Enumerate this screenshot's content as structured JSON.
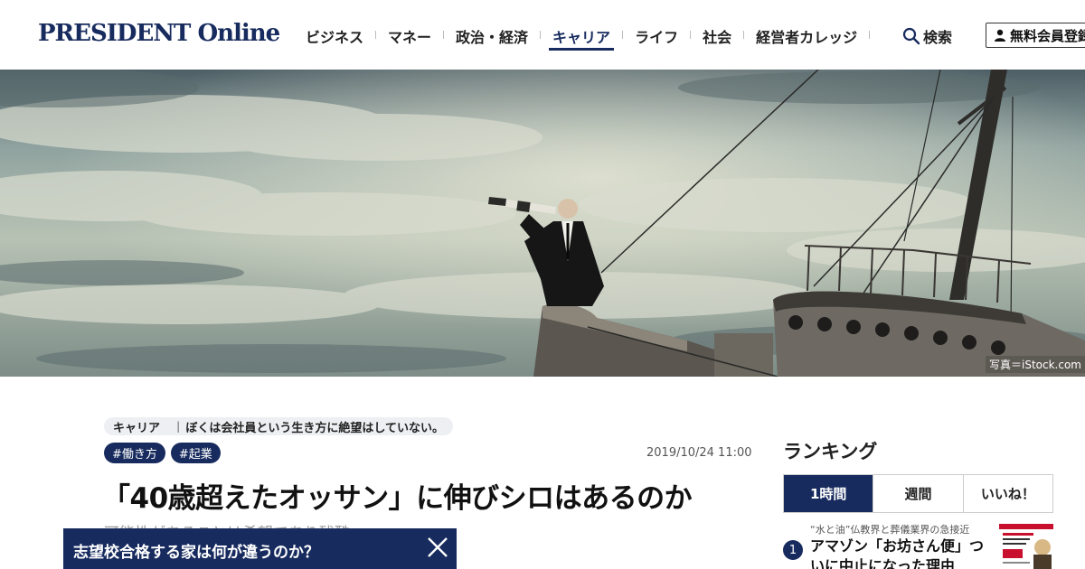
{
  "header": {
    "logo": "PRESIDENT Online",
    "nav": [
      {
        "label": "ビジネス",
        "active": false
      },
      {
        "label": "マネー",
        "active": false
      },
      {
        "label": "政治・経済",
        "active": false
      },
      {
        "label": "キャリア",
        "active": true
      },
      {
        "label": "ライフ",
        "active": false
      },
      {
        "label": "社会",
        "active": false
      },
      {
        "label": "経営者カレッジ",
        "active": false
      }
    ],
    "search_label": "検索",
    "search_icon": "search-icon",
    "member_label": "無料会員登録",
    "member_icon": "person-icon"
  },
  "hero": {
    "credit": "写真＝iStock.com"
  },
  "article": {
    "category": "キャリア",
    "series": "ぼくは会社員という生き方に絶望はしていない。",
    "hashtags": [
      "#働き方",
      "#起業"
    ],
    "date": "2019/10/24 11:00",
    "title": "「40歳超えたオッサン」に伸びシロはあるのか",
    "subtitle": "可能性があることは希望であり残酷"
  },
  "banner": {
    "text": "志望校合格する家は何が違うのか？",
    "close_icon": "close-icon"
  },
  "ranking": {
    "title": "ランキング",
    "tabs": [
      "1時間",
      "週間",
      "いいね！"
    ],
    "active_tab": "1時間",
    "items": [
      {
        "rank": "1",
        "sub": "“水と油”仏教界と葬儀業界の急接近",
        "headline": "アマゾン「お坊さん便」ついに中止になった理由"
      }
    ]
  },
  "colors": {
    "brand": "#172b5e",
    "pill_bg": "#edeff2",
    "text": "#222222"
  }
}
